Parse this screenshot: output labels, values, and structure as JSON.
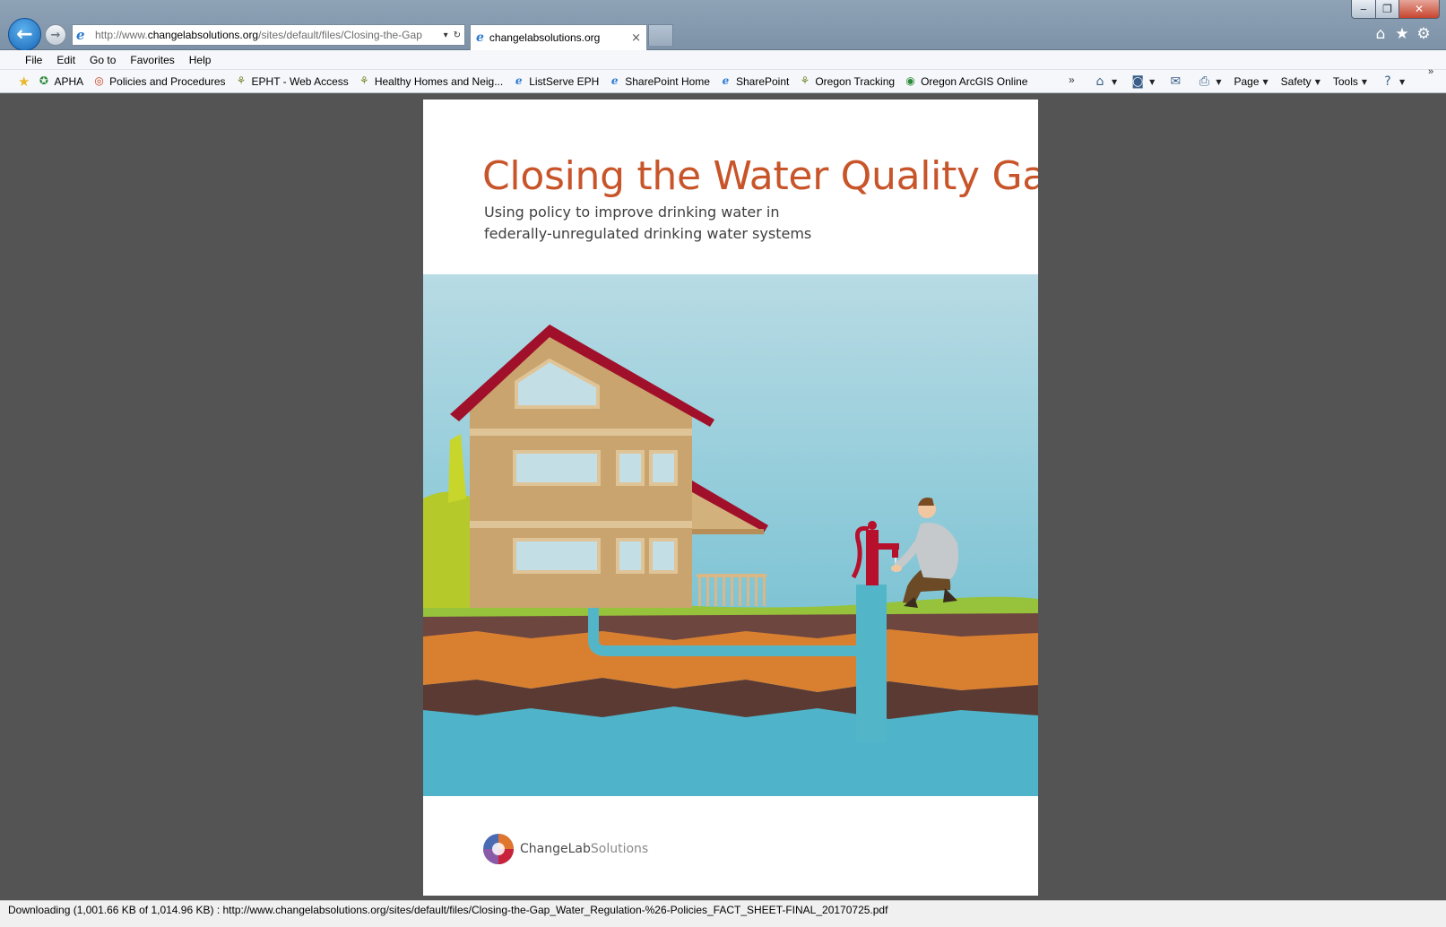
{
  "window": {
    "minimize_glyph": "‒",
    "maximize_glyph": "❐",
    "close_glyph": "✕"
  },
  "nav": {
    "back_glyph": "←",
    "forward_glyph": "→"
  },
  "address": {
    "url_prefix": "http://www.",
    "url_domain": "changelabsolutions.org",
    "url_path": "/sites/default/files/Closing-the-Gap",
    "dropdown_glyph": "▾",
    "refresh_glyph": "↻"
  },
  "tab": {
    "label": "changelabsolutions.org",
    "close_glyph": "×"
  },
  "toolbar_icons": [
    "home-icon",
    "star-icon",
    "gear-icon"
  ],
  "toolbar_glyphs": {
    "home": "⌂",
    "star": "★",
    "gear": "⚙"
  },
  "menu": [
    "File",
    "Edit",
    "Go to",
    "Favorites",
    "Help"
  ],
  "favorites": [
    {
      "label": "APHA",
      "icon": "globe-icon",
      "glyph": "✪",
      "cls": "ico-globe"
    },
    {
      "label": "Policies and Procedures",
      "icon": "circle-icon",
      "glyph": "◎",
      "cls": "ico-circle"
    },
    {
      "label": "EPHT - Web Access",
      "icon": "tree-icon",
      "glyph": "⚘",
      "cls": "ico-tree"
    },
    {
      "label": "Healthy Homes and Neig...",
      "icon": "tree-icon",
      "glyph": "⚘",
      "cls": "ico-tree"
    },
    {
      "label": "ListServe EPH",
      "icon": "ie-icon",
      "glyph": "e",
      "cls": "ico-ie"
    },
    {
      "label": "SharePoint Home",
      "icon": "ie-icon",
      "glyph": "e",
      "cls": "ico-ie"
    },
    {
      "label": "SharePoint",
      "icon": "ie-icon",
      "glyph": "e",
      "cls": "ico-ie"
    },
    {
      "label": "Oregon Tracking",
      "icon": "tree-icon",
      "glyph": "⚘",
      "cls": "ico-tree"
    },
    {
      "label": "Oregon ArcGIS Online",
      "icon": "globe-icon",
      "glyph": "◉",
      "cls": "ico-globe"
    }
  ],
  "favorites_overflow": "»",
  "commands": [
    {
      "label": "",
      "icon": "home-icon",
      "glyph": "⌂",
      "dropdown": true
    },
    {
      "label": "",
      "icon": "rss-icon",
      "glyph": "◙",
      "dropdown": true
    },
    {
      "label": "",
      "icon": "mail-icon",
      "glyph": "✉",
      "dropdown": false
    },
    {
      "label": "",
      "icon": "print-icon",
      "glyph": "⎙",
      "dropdown": true
    },
    {
      "label": "Page",
      "icon": "",
      "glyph": "",
      "dropdown": true
    },
    {
      "label": "Safety",
      "icon": "",
      "glyph": "",
      "dropdown": true
    },
    {
      "label": "Tools",
      "icon": "",
      "glyph": "",
      "dropdown": true
    },
    {
      "label": "",
      "icon": "help-icon",
      "glyph": "?",
      "dropdown": true
    }
  ],
  "commands_overflow": "»",
  "document": {
    "title": "Closing the Water Quality Gap",
    "subtitle_line1": "Using policy to improve drinking water in",
    "subtitle_line2": "federally-unregulated drinking water systems",
    "brand_primary": "ChangeLab",
    "brand_secondary": "Solutions",
    "title_color": "#c8552a"
  },
  "status": {
    "text": "Downloading (1,001.66 KB of 1,014.96 KB) : http://www.changelabsolutions.org/sites/default/files/Closing-the-Gap_Water_Regulation-%26-Policies_FACT_SHEET-FINAL_20170725.pdf"
  }
}
